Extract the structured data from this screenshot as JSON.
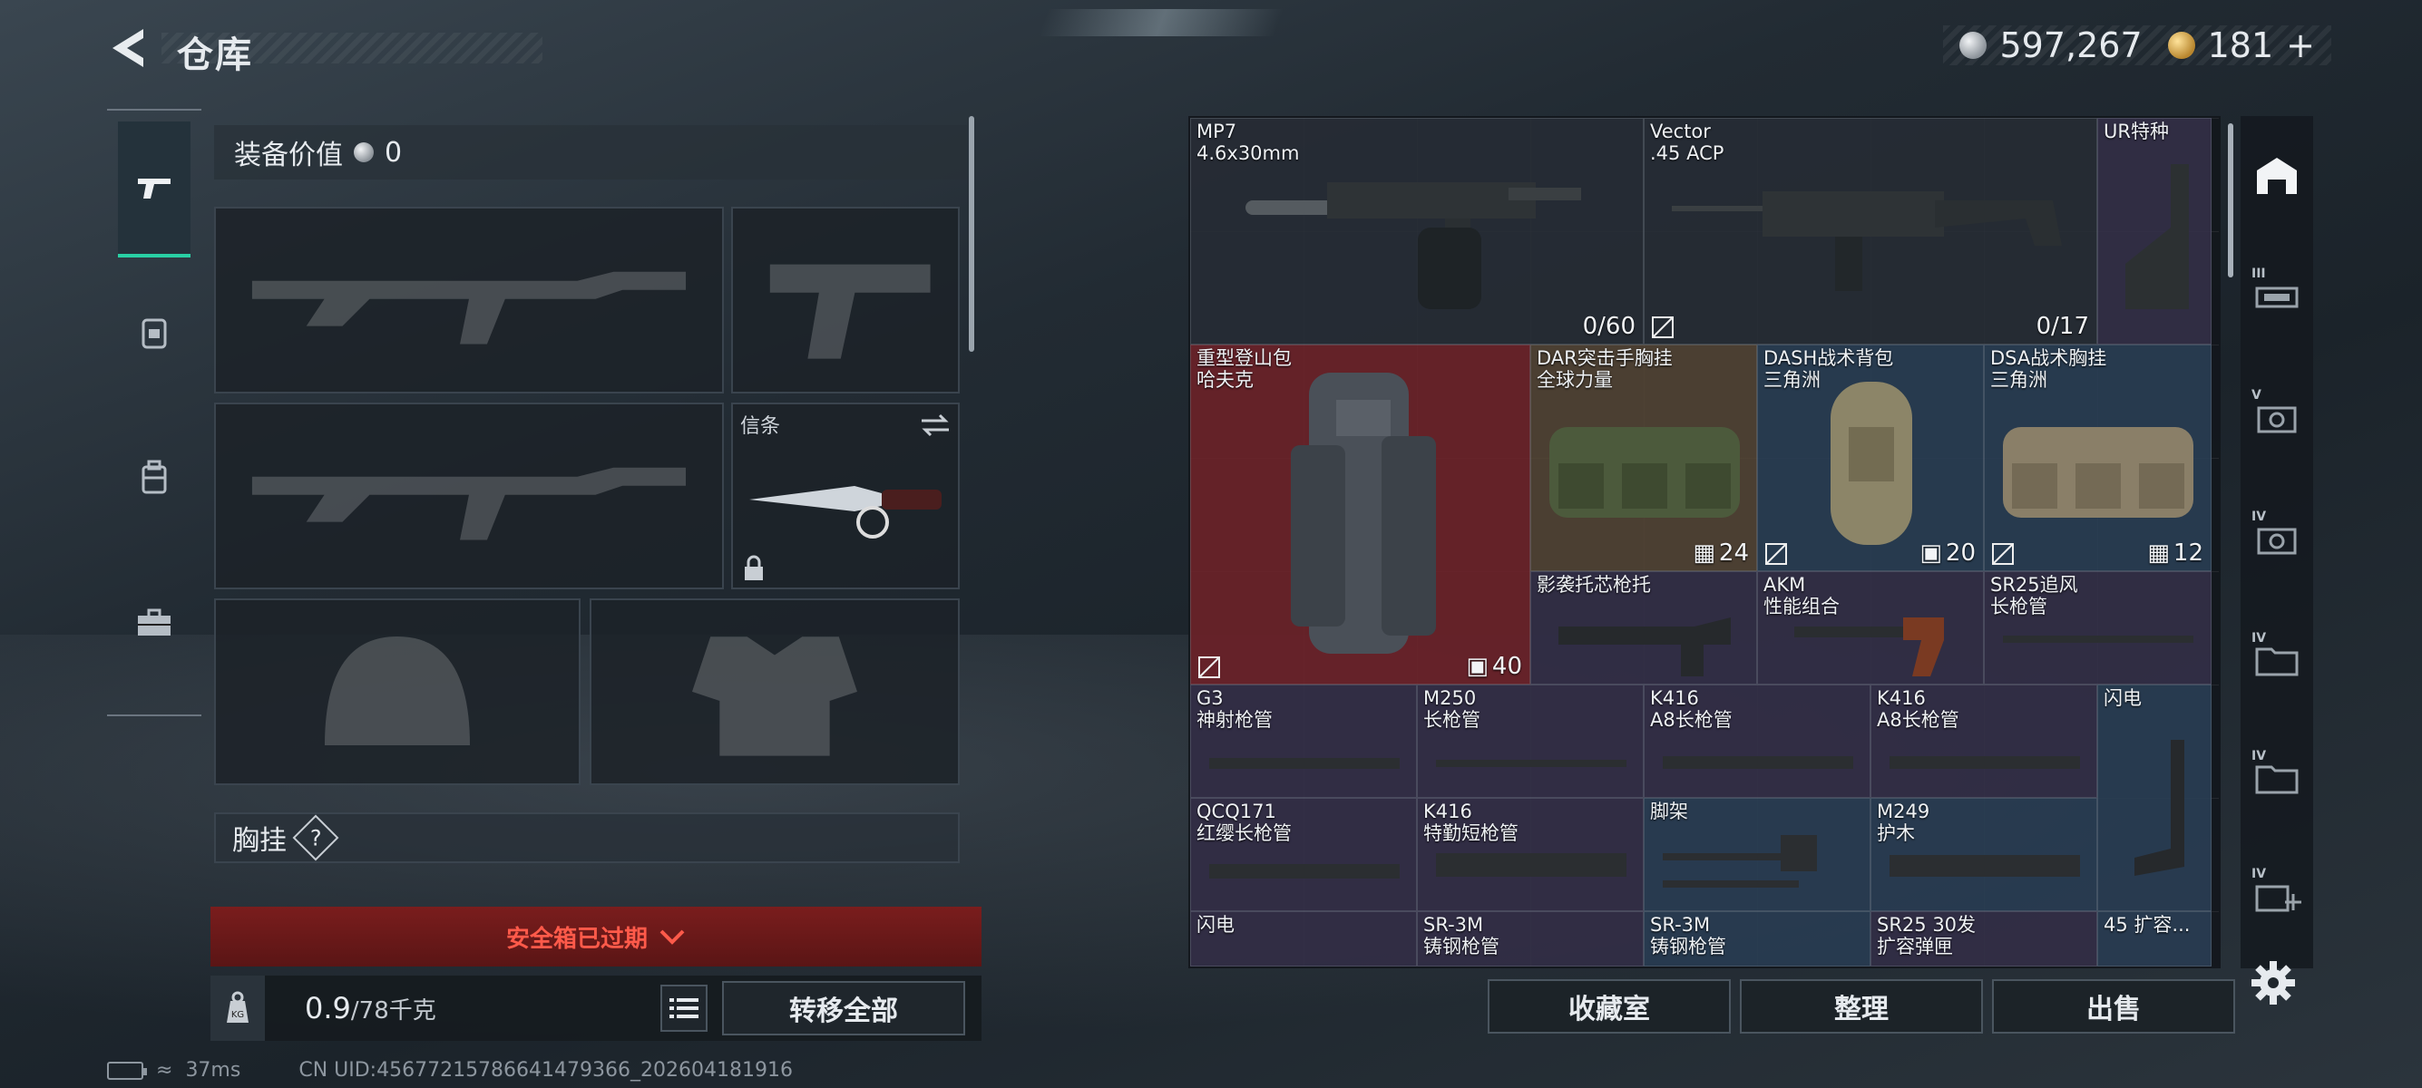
{
  "header": {
    "title": "仓库",
    "currency_silver": "597,267",
    "currency_gold": "181",
    "gold_plus": "+"
  },
  "left_tabs": [
    {
      "name": "weapons",
      "icon": "pistol-icon",
      "active": true
    },
    {
      "name": "gear",
      "icon": "backpack-armor-icon",
      "active": false
    },
    {
      "name": "bags",
      "icon": "backpack-icon",
      "active": false
    },
    {
      "name": "tools",
      "icon": "toolbox-icon",
      "active": false
    }
  ],
  "loadout": {
    "equip_value_label": "装备价值",
    "equip_value": "0",
    "melee_slot_label": "信条",
    "chest_rig_label": "胸挂",
    "help_symbol": "?",
    "safebox_expired": "安全箱已过期",
    "weight_value": "0.9",
    "weight_max": "/78千克",
    "kg_label": "KG",
    "transfer_all": "转移全部"
  },
  "stash": {
    "items": [
      {
        "id": "mp7",
        "name": "MP7\n4.6x30mm",
        "count": "0/60",
        "bg": "gray"
      },
      {
        "id": "vector",
        "name": "Vector\n.45 ACP",
        "count": "0/17",
        "bg": "gray"
      },
      {
        "id": "ur",
        "name": "UR特种",
        "count": "",
        "bg": "purple"
      },
      {
        "id": "hiking-pack",
        "name": "重型登山包\n哈夫克",
        "count": "40",
        "bg": "red"
      },
      {
        "id": "dar-rig",
        "name": "DAR突击手胸挂\n全球力量",
        "count": "24",
        "bg": "brown"
      },
      {
        "id": "dash-pack",
        "name": "DASH战术背包\n三角洲",
        "count": "20",
        "bg": "blue"
      },
      {
        "id": "dsa-rig",
        "name": "DSA战术胸挂\n三角洲",
        "count": "12",
        "bg": "blue"
      },
      {
        "id": "shadow-stock",
        "name": "影袭托芯枪托",
        "count": "",
        "bg": "purple"
      },
      {
        "id": "akm-grip",
        "name": "AKM\n性能组合",
        "count": "",
        "bg": "purple"
      },
      {
        "id": "sr25-barrel",
        "name": "SR25追风\n长枪管",
        "count": "",
        "bg": "purple"
      },
      {
        "id": "g3-barrel",
        "name": "G3\n神射枪管",
        "count": "",
        "bg": "purple"
      },
      {
        "id": "m250-barrel",
        "name": "M250\n长枪管",
        "count": "",
        "bg": "purple"
      },
      {
        "id": "k416-a8-1",
        "name": "K416\nA8长枪管",
        "count": "",
        "bg": "purple"
      },
      {
        "id": "k416-a8-2",
        "name": "K416\nA8长枪管",
        "count": "",
        "bg": "purple"
      },
      {
        "id": "flash-1",
        "name": "闪电",
        "count": "",
        "bg": "blue"
      },
      {
        "id": "qcq171",
        "name": "QCQ171\n红缨长枪管",
        "count": "",
        "bg": "purple"
      },
      {
        "id": "k416-short",
        "name": "K416\n特勤短枪管",
        "count": "",
        "bg": "purple"
      },
      {
        "id": "bipod",
        "name": "脚架",
        "count": "",
        "bg": "blue"
      },
      {
        "id": "m249-handguard",
        "name": "M249\n护木",
        "count": "",
        "bg": "blue"
      },
      {
        "id": "flash-2",
        "name": "闪电",
        "count": "",
        "bg": "purple"
      },
      {
        "id": "sr3m-1",
        "name": "SR-3M\n铸钢枪管",
        "count": "",
        "bg": "purple"
      },
      {
        "id": "sr3m-2",
        "name": "SR-3M\n铸钢枪管",
        "count": "",
        "bg": "blue"
      },
      {
        "id": "sr25-mag",
        "name": "SR25 30发\n扩容弹匣",
        "count": "",
        "bg": "purple"
      },
      {
        "id": "mag45",
        "name": "45 扩容...",
        "count": "",
        "bg": "blue"
      }
    ]
  },
  "stash_actions": {
    "collection": "收藏室",
    "sort": "整理",
    "sell": "出售"
  },
  "right_tabs": [
    {
      "label": "",
      "icon": "warehouse-icon"
    },
    {
      "label": "III",
      "icon": "weapon-case-icon"
    },
    {
      "label": "V",
      "icon": "ammo-box-icon"
    },
    {
      "label": "IV",
      "icon": "ammo-box-icon"
    },
    {
      "label": "IV",
      "icon": "folder-icon"
    },
    {
      "label": "IV",
      "icon": "folder-icon"
    },
    {
      "label": "IV",
      "icon": "add-case-icon"
    }
  ],
  "footer": {
    "ping": "37ms",
    "uid": "CN UID:45677215786641479366_202604181916"
  },
  "colors": {
    "accent": "#29d0a4",
    "warning": "#ff5a4a",
    "expired_bg": "#6a1919"
  }
}
